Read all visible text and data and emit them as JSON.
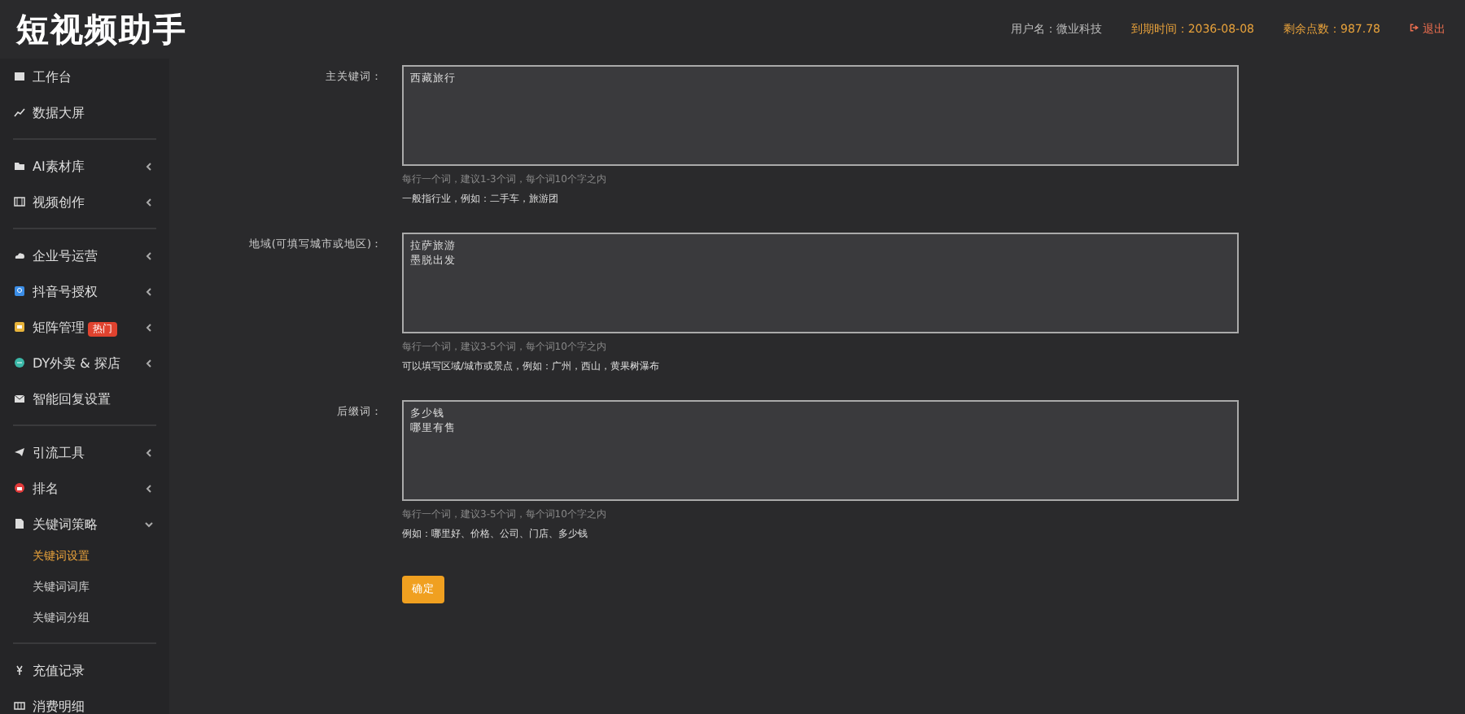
{
  "header": {
    "logo": "短视频助手",
    "user": "用户名：微业科技",
    "expiry": "到期时间：2036-08-08",
    "points": "剩余点数：987.78",
    "logout": "退出"
  },
  "sidebar": {
    "groups": [
      [
        {
          "label": "工作台",
          "expandable": false
        },
        {
          "label": "数据大屏",
          "expandable": false
        }
      ],
      [
        {
          "label": "AI素材库",
          "expandable": true,
          "expanded": false
        },
        {
          "label": "视频创作",
          "expandable": true,
          "expanded": false
        }
      ],
      [
        {
          "label": "企业号运营",
          "expandable": true,
          "expanded": false
        },
        {
          "label": "抖音号授权",
          "expandable": true,
          "expanded": false
        },
        {
          "label": "矩阵管理",
          "badge": "热门",
          "expandable": true,
          "expanded": false
        },
        {
          "label": "DY外卖 & 探店",
          "expandable": true,
          "expanded": false
        },
        {
          "label": "智能回复设置",
          "expandable": false
        }
      ],
      [
        {
          "label": "引流工具",
          "expandable": true,
          "expanded": false
        },
        {
          "label": "排名",
          "expandable": true,
          "expanded": false
        },
        {
          "label": "关键词策略",
          "expandable": true,
          "expanded": true,
          "children": [
            {
              "label": "关键词设置",
              "selected": true
            },
            {
              "label": "关键词词库",
              "selected": false
            },
            {
              "label": "关键词分组",
              "selected": false
            }
          ]
        }
      ],
      [
        {
          "label": "充值记录",
          "expandable": false
        },
        {
          "label": "消费明细",
          "expandable": false
        }
      ]
    ]
  },
  "form": {
    "fields": [
      {
        "label": "主关键词：",
        "lines": [
          "西藏旅行"
        ],
        "hint": "每行一个词，建议1-3个词，每个词10个字之内",
        "example": "一般指行业，例如：二手车，旅游团"
      },
      {
        "label": "地域(可填写城市或地区)：",
        "lines": [
          "拉萨旅游",
          "墨脱出发"
        ],
        "hint": "每行一个词，建议3-5个词，每个词10个字之内",
        "example": "可以填写区域/城市或景点，例如：广州，西山，黄果树瀑布"
      },
      {
        "label": "后缀词：",
        "lines": [
          "多少钱",
          "哪里有售"
        ],
        "hint": "每行一个词，建议3-5个词，每个词10个字之内",
        "example": "例如：哪里好、价格、公司、门店、多少钱"
      }
    ],
    "submit": "确定"
  }
}
